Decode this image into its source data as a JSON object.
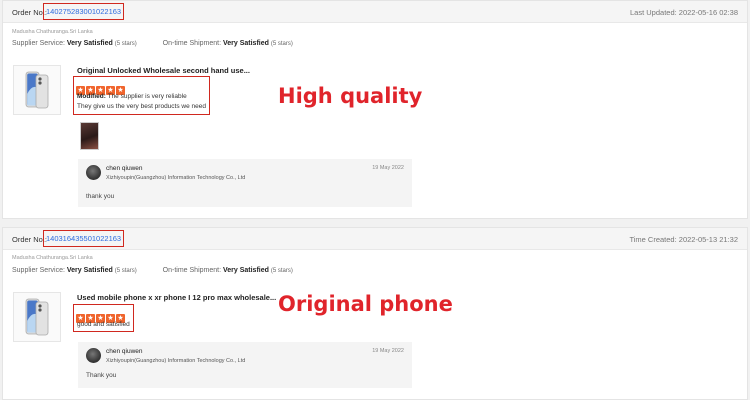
{
  "reviews": [
    {
      "order_label": "Order No.:",
      "order_no": "140275283001022163",
      "date_text": "Last Updated: 2022-05-16 02:38",
      "buyer": "Madusha Chathuranga.Sri Lanka",
      "supplier_service_label": "Supplier Service:",
      "supplier_service_value": "Very Satisfied",
      "supplier_service_stars": "(5 stars)",
      "shipment_label": "On-time Shipment:",
      "shipment_value": "Very Satisfied",
      "shipment_stars": "(5 stars)",
      "product_title": "Original Unlocked Wholesale second hand use...",
      "rating": 5,
      "feedback_prefix": "Modified:",
      "feedback_line1": "The supplier is very reliable",
      "feedback_line2": "They give us the very best products we need",
      "caption": "High quality",
      "reply": {
        "name": "chen qiuwen",
        "company": "Xizhiyoupin(Guangzhou) Information Technology Co., Ltd",
        "date": "19 May 2022",
        "text": "thank you"
      }
    },
    {
      "order_label": "Order No.:",
      "order_no": "140316435501022163",
      "date_text": "Time Created: 2022-05-13 21:32",
      "buyer": "Madusha Chathuranga.Sri Lanka",
      "supplier_service_label": "Supplier Service:",
      "supplier_service_value": "Very Satisfied",
      "supplier_service_stars": "(5 stars)",
      "shipment_label": "On-time Shipment:",
      "shipment_value": "Very Satisfied",
      "shipment_stars": "(5 stars)",
      "product_title": "Used mobile phone x xr phone I 12 pro max wholesale...",
      "rating": 5,
      "feedback_line1": "good and satisfied",
      "caption": "Original phone",
      "reply": {
        "name": "chen qiuwen",
        "company": "Xizhiyoupin(Guangzhou) Information Technology Co., Ltd",
        "date": "19 May 2022",
        "text": "Thank you"
      }
    }
  ],
  "colors": {
    "highlight_red": "#d0281f",
    "caption_red": "#e0242b",
    "star_orange": "#f0642c",
    "link_blue": "#2d6cdf"
  },
  "icons": {
    "star": "star-icon",
    "phone": "phone-thumbnail"
  }
}
